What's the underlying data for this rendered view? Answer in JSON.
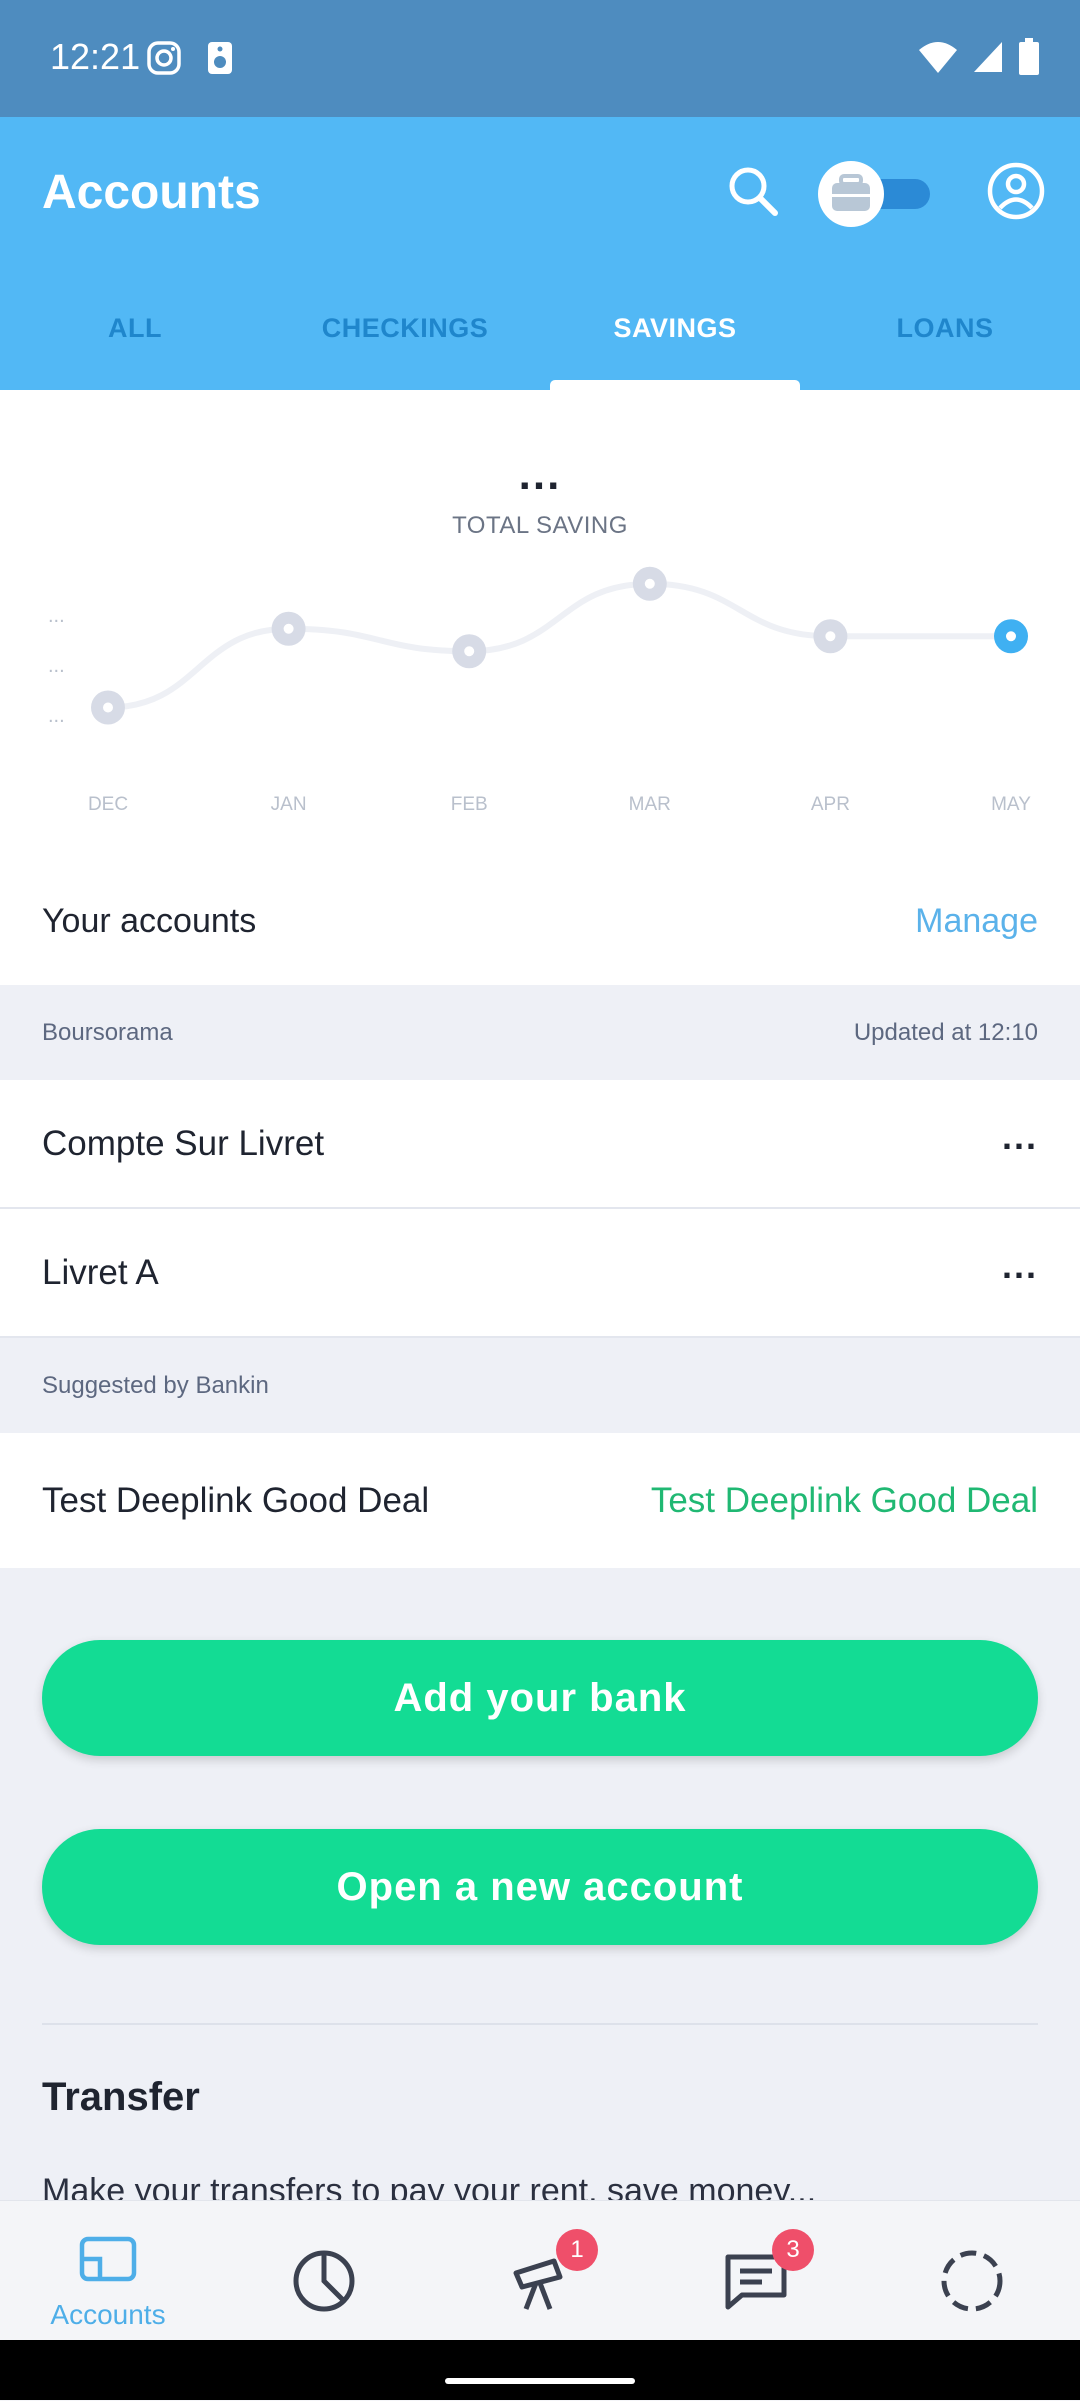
{
  "status_bar": {
    "time": "12:21",
    "icons": [
      "instagram-icon",
      "speaker-icon",
      "wifi-icon",
      "cell-signal-icon",
      "battery-icon"
    ]
  },
  "app_bar": {
    "title": "Accounts",
    "tabs": [
      {
        "label": "ALL",
        "active": false
      },
      {
        "label": "CHECKINGS",
        "active": false
      },
      {
        "label": "SAVINGS",
        "active": true
      },
      {
        "label": "LOANS",
        "active": false
      }
    ]
  },
  "chart": {
    "value": "...",
    "title": "TOTAL SAVING",
    "y_tick_labels": [
      "...",
      "...",
      "..."
    ],
    "selected_point": "MAY"
  },
  "chart_data": {
    "type": "line",
    "title": "TOTAL SAVING",
    "categories": [
      "DEC",
      "JAN",
      "FEB",
      "MAR",
      "APR",
      "MAY"
    ],
    "values": [
      1.2,
      3.3,
      2.7,
      4.5,
      3.1,
      3.1
    ],
    "grid": false,
    "note_values": "relative levels, amounts hidden"
  },
  "accounts_section": {
    "title": "Your accounts",
    "manage_label": "Manage",
    "bank": {
      "name": "Boursorama",
      "updated": "Updated at 12:10"
    },
    "accounts": [
      {
        "name": "Compte Sur Livret",
        "amount": "..."
      },
      {
        "name": "Livret A",
        "amount": "..."
      }
    ],
    "suggested_label": "Suggested by Bankin",
    "deal": {
      "name": "Test Deeplink Good Deal",
      "value": "Test Deeplink Good Deal"
    }
  },
  "buttons": {
    "add_bank": "Add your bank",
    "open_account": "Open a new account"
  },
  "transfer": {
    "title": "Transfer",
    "text": "Make your transfers to pay your rent, save money..."
  },
  "bottom_nav": {
    "items": [
      {
        "label": "Accounts",
        "icon": "accounts-icon",
        "active": true
      },
      {
        "label": "",
        "icon": "analysis-pie-icon",
        "active": false
      },
      {
        "label": "",
        "icon": "explore-telescope-icon",
        "badge": "1"
      },
      {
        "label": "",
        "icon": "messages-icon",
        "badge": "3"
      },
      {
        "label": "",
        "icon": "loading-circle-icon"
      }
    ]
  },
  "colors": {
    "accent": "#52b8f5",
    "green": "#13dc94",
    "status_bar": "#4e8cbf"
  }
}
